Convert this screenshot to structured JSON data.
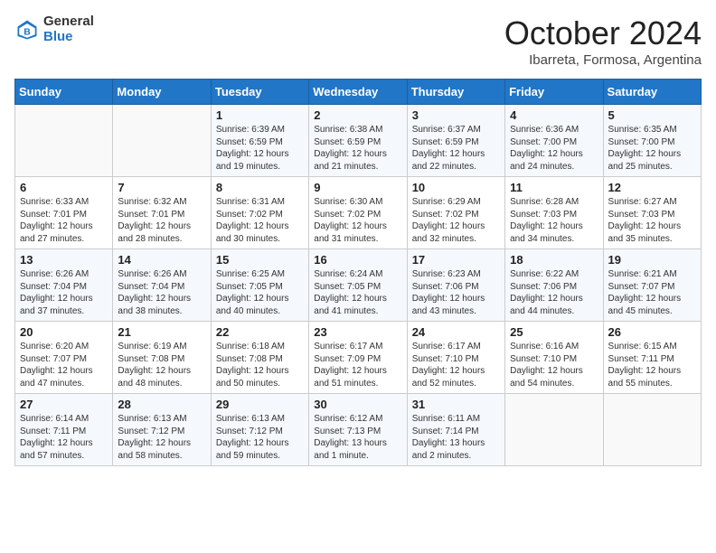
{
  "header": {
    "logo_general": "General",
    "logo_blue": "Blue",
    "month_title": "October 2024",
    "subtitle": "Ibarreta, Formosa, Argentina"
  },
  "weekdays": [
    "Sunday",
    "Monday",
    "Tuesday",
    "Wednesday",
    "Thursday",
    "Friday",
    "Saturday"
  ],
  "weeks": [
    [
      {
        "day": "",
        "info": ""
      },
      {
        "day": "",
        "info": ""
      },
      {
        "day": "1",
        "info": "Sunrise: 6:39 AM\nSunset: 6:59 PM\nDaylight: 12 hours\nand 19 minutes."
      },
      {
        "day": "2",
        "info": "Sunrise: 6:38 AM\nSunset: 6:59 PM\nDaylight: 12 hours\nand 21 minutes."
      },
      {
        "day": "3",
        "info": "Sunrise: 6:37 AM\nSunset: 6:59 PM\nDaylight: 12 hours\nand 22 minutes."
      },
      {
        "day": "4",
        "info": "Sunrise: 6:36 AM\nSunset: 7:00 PM\nDaylight: 12 hours\nand 24 minutes."
      },
      {
        "day": "5",
        "info": "Sunrise: 6:35 AM\nSunset: 7:00 PM\nDaylight: 12 hours\nand 25 minutes."
      }
    ],
    [
      {
        "day": "6",
        "info": "Sunrise: 6:33 AM\nSunset: 7:01 PM\nDaylight: 12 hours\nand 27 minutes."
      },
      {
        "day": "7",
        "info": "Sunrise: 6:32 AM\nSunset: 7:01 PM\nDaylight: 12 hours\nand 28 minutes."
      },
      {
        "day": "8",
        "info": "Sunrise: 6:31 AM\nSunset: 7:02 PM\nDaylight: 12 hours\nand 30 minutes."
      },
      {
        "day": "9",
        "info": "Sunrise: 6:30 AM\nSunset: 7:02 PM\nDaylight: 12 hours\nand 31 minutes."
      },
      {
        "day": "10",
        "info": "Sunrise: 6:29 AM\nSunset: 7:02 PM\nDaylight: 12 hours\nand 32 minutes."
      },
      {
        "day": "11",
        "info": "Sunrise: 6:28 AM\nSunset: 7:03 PM\nDaylight: 12 hours\nand 34 minutes."
      },
      {
        "day": "12",
        "info": "Sunrise: 6:27 AM\nSunset: 7:03 PM\nDaylight: 12 hours\nand 35 minutes."
      }
    ],
    [
      {
        "day": "13",
        "info": "Sunrise: 6:26 AM\nSunset: 7:04 PM\nDaylight: 12 hours\nand 37 minutes."
      },
      {
        "day": "14",
        "info": "Sunrise: 6:26 AM\nSunset: 7:04 PM\nDaylight: 12 hours\nand 38 minutes."
      },
      {
        "day": "15",
        "info": "Sunrise: 6:25 AM\nSunset: 7:05 PM\nDaylight: 12 hours\nand 40 minutes."
      },
      {
        "day": "16",
        "info": "Sunrise: 6:24 AM\nSunset: 7:05 PM\nDaylight: 12 hours\nand 41 minutes."
      },
      {
        "day": "17",
        "info": "Sunrise: 6:23 AM\nSunset: 7:06 PM\nDaylight: 12 hours\nand 43 minutes."
      },
      {
        "day": "18",
        "info": "Sunrise: 6:22 AM\nSunset: 7:06 PM\nDaylight: 12 hours\nand 44 minutes."
      },
      {
        "day": "19",
        "info": "Sunrise: 6:21 AM\nSunset: 7:07 PM\nDaylight: 12 hours\nand 45 minutes."
      }
    ],
    [
      {
        "day": "20",
        "info": "Sunrise: 6:20 AM\nSunset: 7:07 PM\nDaylight: 12 hours\nand 47 minutes."
      },
      {
        "day": "21",
        "info": "Sunrise: 6:19 AM\nSunset: 7:08 PM\nDaylight: 12 hours\nand 48 minutes."
      },
      {
        "day": "22",
        "info": "Sunrise: 6:18 AM\nSunset: 7:08 PM\nDaylight: 12 hours\nand 50 minutes."
      },
      {
        "day": "23",
        "info": "Sunrise: 6:17 AM\nSunset: 7:09 PM\nDaylight: 12 hours\nand 51 minutes."
      },
      {
        "day": "24",
        "info": "Sunrise: 6:17 AM\nSunset: 7:10 PM\nDaylight: 12 hours\nand 52 minutes."
      },
      {
        "day": "25",
        "info": "Sunrise: 6:16 AM\nSunset: 7:10 PM\nDaylight: 12 hours\nand 54 minutes."
      },
      {
        "day": "26",
        "info": "Sunrise: 6:15 AM\nSunset: 7:11 PM\nDaylight: 12 hours\nand 55 minutes."
      }
    ],
    [
      {
        "day": "27",
        "info": "Sunrise: 6:14 AM\nSunset: 7:11 PM\nDaylight: 12 hours\nand 57 minutes."
      },
      {
        "day": "28",
        "info": "Sunrise: 6:13 AM\nSunset: 7:12 PM\nDaylight: 12 hours\nand 58 minutes."
      },
      {
        "day": "29",
        "info": "Sunrise: 6:13 AM\nSunset: 7:12 PM\nDaylight: 12 hours\nand 59 minutes."
      },
      {
        "day": "30",
        "info": "Sunrise: 6:12 AM\nSunset: 7:13 PM\nDaylight: 13 hours\nand 1 minute."
      },
      {
        "day": "31",
        "info": "Sunrise: 6:11 AM\nSunset: 7:14 PM\nDaylight: 13 hours\nand 2 minutes."
      },
      {
        "day": "",
        "info": ""
      },
      {
        "day": "",
        "info": ""
      }
    ]
  ]
}
